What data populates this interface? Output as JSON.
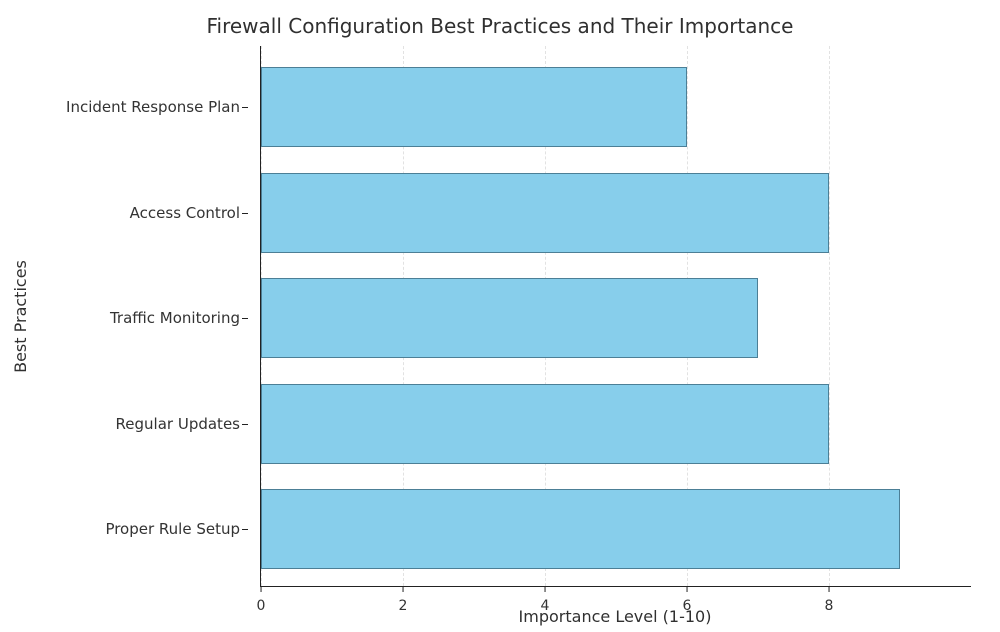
{
  "chart_data": {
    "type": "bar",
    "orientation": "horizontal",
    "title": "Firewall Configuration Best Practices and Their Importance",
    "xlabel": "Importance Level (1-10)",
    "ylabel": "Best Practices",
    "xlim": [
      0,
      10
    ],
    "xticks": [
      0,
      2,
      4,
      6,
      8
    ],
    "categories": [
      "Proper Rule Setup",
      "Regular Updates",
      "Traffic Monitoring",
      "Access Control",
      "Incident Response Plan"
    ],
    "values": [
      9,
      8,
      7,
      8,
      6
    ],
    "bar_color": "#87ceeb"
  }
}
